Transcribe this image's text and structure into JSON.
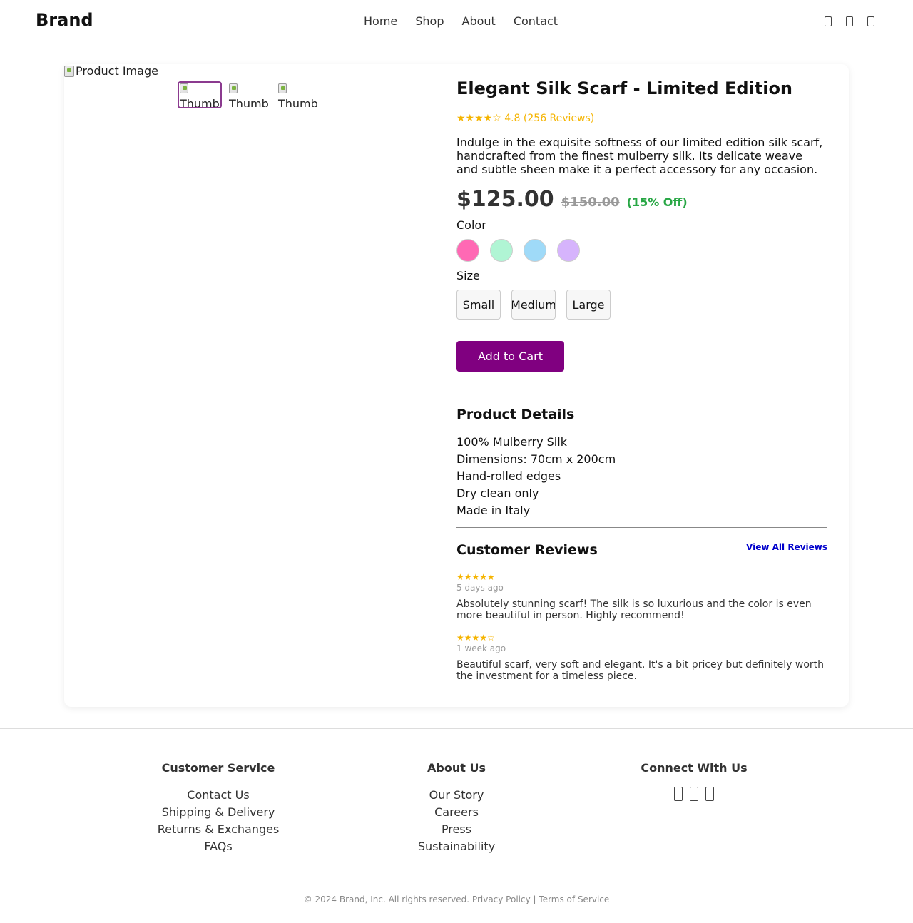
{
  "header": {
    "brand": "Brand",
    "nav": [
      "Home",
      "Shop",
      "About",
      "Contact"
    ],
    "icons": [
      "search-icon",
      "user-icon",
      "cart-icon"
    ]
  },
  "product": {
    "main_image_alt": "Product Image",
    "thumbnail_alts": [
      "Thumbnail",
      "Thumbnail",
      "Thumbnail"
    ],
    "title": "Elegant Silk Scarf - Limited Edition",
    "rating_text": "★★★★☆ 4.8 (256 Reviews)",
    "description": "Indulge in the exquisite softness of our limited edition silk scarf, handcrafted from the finest mulberry silk. Its delicate weave and subtle sheen make it a perfect accessory for any occasion.",
    "price": "$125.00",
    "old_price": "$150.00",
    "discount": "(15% Off)",
    "color_label": "Color",
    "colors": [
      "#ff69b4",
      "#b0f5d4",
      "#9fdaf8",
      "#d6b4fc"
    ],
    "size_label": "Size",
    "sizes": [
      "Small",
      "Medium",
      "Large"
    ],
    "add_to_cart": "Add to Cart",
    "details_title": "Product Details",
    "details": [
      "100% Mulberry Silk",
      "Dimensions: 70cm x 200cm",
      "Hand-rolled edges",
      "Dry clean only",
      "Made in Italy"
    ],
    "reviews_title": "Customer Reviews",
    "view_all": "View All Reviews",
    "reviews": [
      {
        "stars": "★★★★★",
        "when": "5 days ago",
        "text": "Absolutely stunning scarf! The silk is so luxurious and the color is even more beautiful in person. Highly recommend!"
      },
      {
        "stars": "★★★★☆",
        "when": "1 week ago",
        "text": "Beautiful scarf, very soft and elegant. It's a bit pricey but definitely worth the investment for a timeless piece."
      }
    ]
  },
  "footer": {
    "customer_service": {
      "title": "Customer Service",
      "links": [
        "Contact Us",
        "Shipping & Delivery",
        "Returns & Exchanges",
        "FAQs"
      ]
    },
    "about": {
      "title": "About Us",
      "links": [
        "Our Story",
        "Careers",
        "Press",
        "Sustainability"
      ]
    },
    "connect": {
      "title": "Connect With Us",
      "icons": [
        "facebook-icon",
        "instagram-icon",
        "twitter-icon"
      ]
    },
    "copyright": "© 2024 Brand, Inc. All rights reserved.",
    "privacy": "Privacy Policy",
    "separator": "|",
    "terms": "Terms of Service"
  }
}
